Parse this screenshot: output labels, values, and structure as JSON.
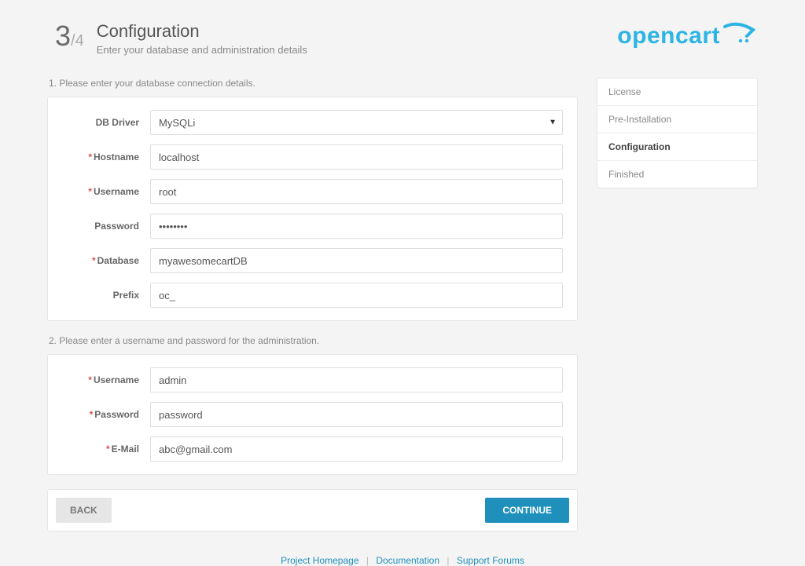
{
  "header": {
    "current_step": "3",
    "total_steps": "/4",
    "title": "Configuration",
    "subtitle": "Enter your database and administration details"
  },
  "logo": {
    "text": "opencart"
  },
  "section1": {
    "label": "1. Please enter your database connection details.",
    "fields": {
      "db_driver": {
        "label": "DB Driver",
        "value": "MySQLi",
        "required": false
      },
      "hostname": {
        "label": "Hostname",
        "value": "localhost",
        "required": true
      },
      "username": {
        "label": "Username",
        "value": "root",
        "required": true
      },
      "password": {
        "label": "Password",
        "value": "••••••••",
        "required": false
      },
      "database": {
        "label": "Database",
        "value": "myawesomecartDB",
        "required": true
      },
      "prefix": {
        "label": "Prefix",
        "value": "oc_",
        "required": false
      }
    }
  },
  "section2": {
    "label": "2. Please enter a username and password for the administration.",
    "fields": {
      "username": {
        "label": "Username",
        "value": "admin",
        "required": true
      },
      "password": {
        "label": "Password",
        "value": "password",
        "required": true
      },
      "email": {
        "label": "E-Mail",
        "value": "abc@gmail.com",
        "required": true
      }
    }
  },
  "buttons": {
    "back": "BACK",
    "continue": "CONTINUE"
  },
  "steps": {
    "items": [
      {
        "label": "License",
        "active": false
      },
      {
        "label": "Pre-Installation",
        "active": false
      },
      {
        "label": "Configuration",
        "active": true
      },
      {
        "label": "Finished",
        "active": false
      }
    ]
  },
  "footer": {
    "links": [
      "Project Homepage",
      "Documentation",
      "Support Forums"
    ]
  }
}
